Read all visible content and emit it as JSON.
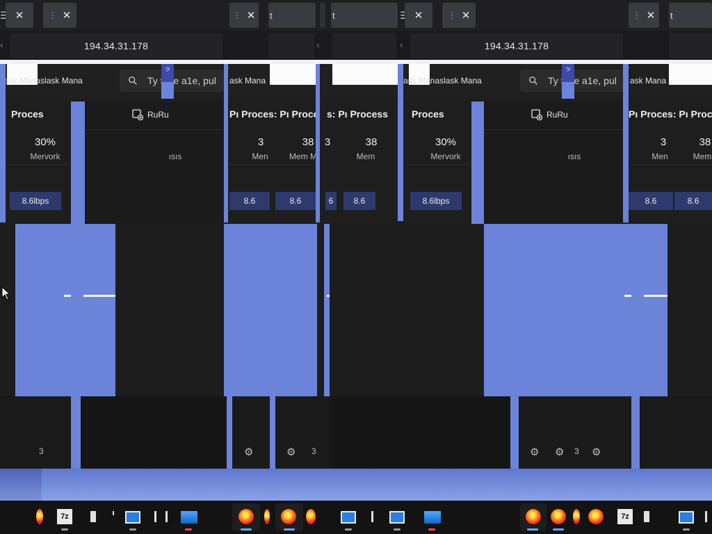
{
  "browser": {
    "address": "194.34.31.178",
    "tab_text": "t",
    "close_glyph": "✕",
    "dots_glyph": "⋮"
  },
  "taskmgr": {
    "title": "ask Manaslask Mana",
    "title_short": "ask Mana",
    "search_placeholder": "Ty type a1e, pul",
    "run_label": "RuRu",
    "processes_head": "Proces",
    "processes_head_multi": "Pı Proces: Pı Processes",
    "processes_head_mid": "s: Pı Process",
    "proc_col": "Pı Process",
    "memory_pct": "30%",
    "memory_label": "Mervork",
    "mem_short": "Men",
    "mem_short2": "Mem M",
    "mem_short3": "Mem",
    "val_3": "3",
    "val_38": "38",
    "val_3b": "3",
    "net_value": "8.6lbps",
    "net_short": "8.6",
    "net_short_b": "6",
    "col_label": "ısıs",
    "gear_num": "3",
    "top_chip": "ッ",
    "top_chip_b": "ト"
  },
  "taskbar": {
    "zip_label": "7z"
  },
  "colors": {
    "accent_blue": "#6b84d9",
    "dark_blue": "#3d4aa8",
    "net_highlight": "#2e3a6e",
    "background": "#1c1c1c"
  }
}
